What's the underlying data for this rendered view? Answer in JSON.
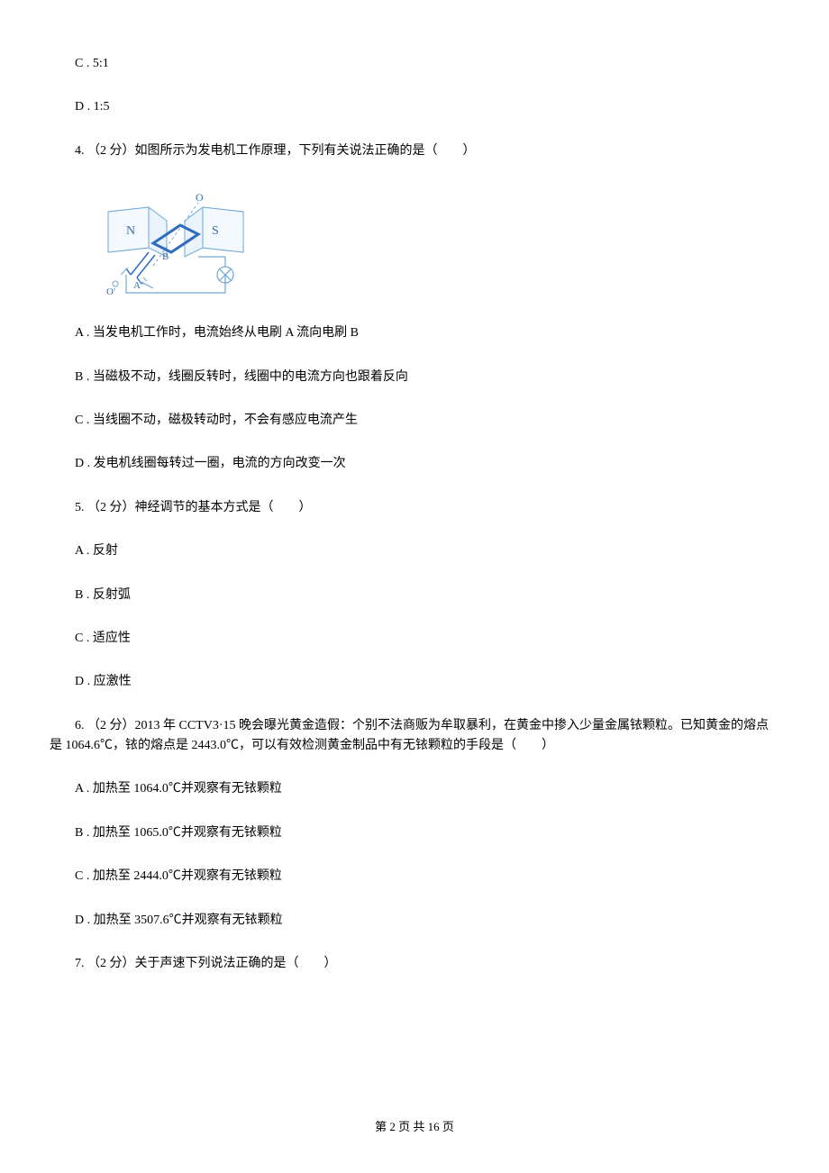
{
  "q3": {
    "optC": "C . 5:1",
    "optD": "D . 1:5"
  },
  "q4": {
    "stem": "4. （2 分）如图所示为发电机工作原理，下列有关说法正确的是（　　）",
    "figure": {
      "N": "N",
      "S": "S",
      "O_top": "O",
      "B": "B",
      "A": "A",
      "O_bottom": "O'"
    },
    "optA": "A . 当发电机工作时，电流始终从电刷 A 流向电刷 B",
    "optB": "B . 当磁极不动，线圈反转时，线圈中的电流方向也跟着反向",
    "optC": "C . 当线圈不动，磁极转动时，不会有感应电流产生",
    "optD": "D . 发电机线圈每转过一圈，电流的方向改变一次"
  },
  "q5": {
    "stem": "5. （2 分）神经调节的基本方式是（　　）",
    "optA": "A . 反射",
    "optB": "B . 反射弧",
    "optC": "C . 适应性",
    "optD": "D . 应激性"
  },
  "q6": {
    "stem": "6. （2 分）2013 年 CCTV3·15 晚会曝光黄金造假：个别不法商贩为牟取暴利，在黄金中掺入少量金属铱颗粒。已知黄金的熔点是 1064.6℃，铱的熔点是 2443.0℃，可以有效检测黄金制品中有无铱颗粒的手段是（　　）",
    "optA": "A . 加热至 1064.0℃并观察有无铱颗粒",
    "optB": "B . 加热至 1065.0℃并观察有无铱颗粒",
    "optC": "C . 加热至 2444.0℃并观察有无铱颗粒",
    "optD": "D . 加热至 3507.6℃并观察有无铱颗粒"
  },
  "q7": {
    "stem": "7. （2 分）关于声速下列说法正确的是（　　）"
  },
  "footer": "第 2 页 共 16 页"
}
